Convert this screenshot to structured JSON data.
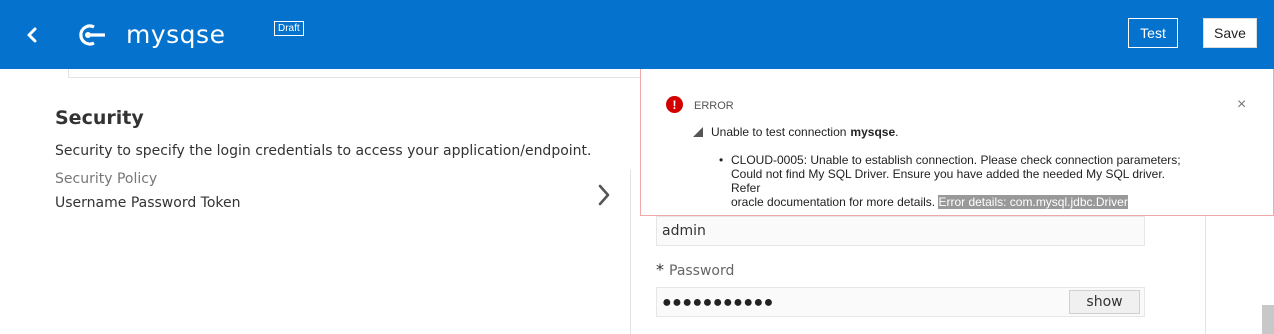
{
  "header": {
    "app_name": "mysqse",
    "badge": "Draft",
    "test_label": "Test",
    "save_label": "Save",
    "bg_color": "#0572ce"
  },
  "section": {
    "title": "Security",
    "description": "Security to specify the login credentials to access your application/endpoint.",
    "policy_label": "Security Policy",
    "policy_value": "Username Password Token"
  },
  "form": {
    "username_value": "admin",
    "password_required_mark": "*",
    "password_label": "Password",
    "password_value": "●●●●●●●●●●●",
    "show_label": "show"
  },
  "error": {
    "title": "ERROR",
    "summary_prefix": "Unable to test connection",
    "summary_name": "mysqse",
    "summary_suffix": ".",
    "bullet": "•",
    "detail_line1": "CLOUD-0005: Unable to establish connection. Please check connection parameters;",
    "detail_line2": "Could not find My SQL Driver. Ensure you have added the needed My SQL driver. Refer",
    "detail_line3": "oracle documentation for more details.",
    "detail_highlight": "Error details: com.mysql.jdbc.Driver",
    "close": "×",
    "icon_color": "#d30000"
  }
}
